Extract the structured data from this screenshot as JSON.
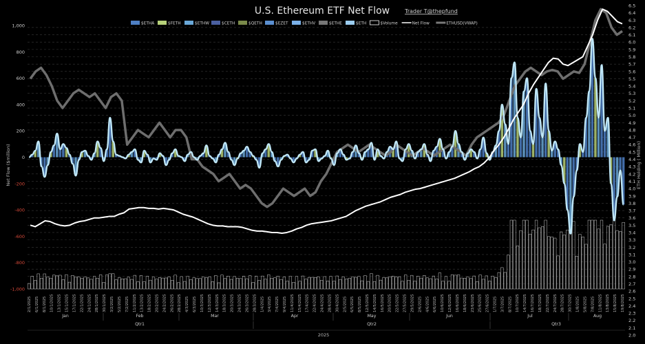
{
  "chart_data": {
    "type": "bar",
    "title": "U.S. Ethereum ETF Net Flow",
    "subtitle": "Trader T@thepfund",
    "ylabel_left": "Net Flow ($million)",
    "ylabel_right": "ETH Holding ( Million)",
    "left_ticks": [
      "1,000",
      "800",
      "600",
      "400",
      "200",
      "0",
      "-200",
      "-400",
      "-600",
      "-800",
      "-1,000"
    ],
    "left_tick_values": [
      1000,
      800,
      600,
      400,
      200,
      0,
      -200,
      -400,
      -600,
      -800,
      -1000
    ],
    "ylim_left": [
      -1000,
      1000
    ],
    "right_ticks": [
      "6.5",
      "6.4",
      "6.3",
      "6.2",
      "6.1",
      "6.0",
      "5.9",
      "5.8",
      "5.7",
      "5.6",
      "5.5",
      "5.4",
      "5.3",
      "5.2",
      "5.1",
      "5.0",
      "4.9",
      "4.8",
      "4.7",
      "4.6",
      "4.5",
      "4.4",
      "4.3",
      "4.2",
      "4.1",
      "4.0",
      "3.9",
      "3.8",
      "3.7",
      "3.6",
      "3.5",
      "3.4",
      "3.3",
      "3.2",
      "3.1",
      "3.0",
      "2.9",
      "2.8",
      "2.7",
      "2.6",
      "2.5",
      "2.4",
      "2.3",
      "2.2",
      "2.1",
      "2.0"
    ],
    "ylim_right": [
      2.0,
      6.5
    ],
    "legend": [
      "$ETHA",
      "$FETH",
      "$ETHW",
      "$CETH",
      "$QETH",
      "$EZET",
      "$ETHV",
      "$ETHE",
      "$ETH",
      "$Volume",
      "Net Flow",
      "ETHUSD(VWAP)"
    ],
    "legend_colors": [
      "#4e7fc4",
      "#b7d17a",
      "#6aa8d8",
      "#4a5fa0",
      "#7a8a4a",
      "#5b8fd0",
      "#7ab0e8",
      "#777777",
      "#9ccdf0",
      "#ffffff",
      "#ffffff",
      "#7a7a7a"
    ],
    "months": [
      "Jan",
      "Feb",
      "Mar",
      "Apr",
      "May",
      "Jun",
      "Jul",
      "Aug"
    ],
    "quarters": [
      "Qtr1",
      "Qtr2",
      "Qtr3"
    ],
    "year": "2025",
    "date_labels": [
      "2/1/2025",
      "6/1/2025",
      "8/1/2025",
      "10/1/2025",
      "13/1/2025",
      "15/1/2025",
      "17/1/2025",
      "22/1/2025",
      "24/1/2025",
      "28/1/2025",
      "30/1/2025",
      "3/2/2025",
      "5/2/2025",
      "7/2/2025",
      "11/2/2025",
      "13/2/2025",
      "18/2/2025",
      "20/2/2025",
      "24/2/2025",
      "26/2/2025",
      "28/2/2025",
      "4/3/2025",
      "6/3/2025",
      "10/3/2025",
      "12/3/2025",
      "14/3/2025",
      "18/3/2025",
      "20/3/2025",
      "24/3/2025",
      "26/3/2025",
      "28/3/2025",
      "1/4/2025",
      "3/4/2025",
      "7/4/2025",
      "9/4/2025",
      "11/4/2025",
      "15/4/2025",
      "17/4/2025",
      "22/4/2025",
      "24/4/2025",
      "28/4/2025",
      "30/4/2025",
      "2/5/2025",
      "6/5/2025",
      "8/5/2025",
      "12/5/2025",
      "14/5/2025",
      "16/5/2025",
      "20/5/2025",
      "22/5/2025",
      "27/5/2025",
      "29/5/2025",
      "2/6/2025",
      "4/6/2025",
      "6/6/2025",
      "10/6/2025",
      "12/6/2025",
      "16/6/2025",
      "18/6/2025",
      "23/6/2025",
      "25/6/2025",
      "27/6/2025",
      "1/7/2025",
      "3/7/2025",
      "8/7/2025",
      "10/7/2025",
      "14/7/2025",
      "16/7/2025",
      "18/7/2025",
      "22/7/2025",
      "24/7/2025",
      "28/7/2025",
      "30/7/2025",
      "1/8/2025",
      "5/8/2025",
      "7/8/2025",
      "11/8/2025",
      "13/8/2025",
      "15/8/2025",
      "19/8/2025"
    ],
    "netflow_series": [
      0,
      20,
      50,
      120,
      -70,
      -150,
      -60,
      40,
      90,
      180,
      60,
      100,
      70,
      20,
      -50,
      -140,
      -20,
      40,
      50,
      10,
      -20,
      30,
      120,
      70,
      -30,
      60,
      300,
      120,
      20,
      10,
      0,
      -10,
      20,
      40,
      60,
      -20,
      -40,
      50,
      20,
      -40,
      -10,
      -20,
      30,
      10,
      -60,
      -20,
      30,
      60,
      10,
      0,
      -30,
      20,
      40,
      0,
      -20,
      10,
      30,
      90,
      10,
      -10,
      -40,
      20,
      60,
      110,
      40,
      -20,
      -60,
      -10,
      30,
      50,
      80,
      40,
      10,
      -20,
      -80,
      30,
      60,
      100,
      40,
      -30,
      -70,
      -20,
      10,
      20,
      -10,
      -40,
      -10,
      20,
      40,
      -40,
      -20,
      50,
      60,
      -30,
      -10,
      10,
      50,
      -10,
      -60,
      30,
      60,
      20,
      -20,
      -10,
      40,
      90,
      30,
      -20,
      40,
      60,
      110,
      -20,
      60,
      10,
      -10,
      40,
      80,
      60,
      120,
      -10,
      -30,
      60,
      100,
      50,
      -10,
      40,
      60,
      100,
      20,
      -30,
      50,
      80,
      140,
      60,
      -10,
      40,
      80,
      200,
      100,
      40,
      -20,
      30,
      60,
      40,
      -10,
      60,
      150,
      30,
      -20,
      40,
      90,
      200,
      400,
      250,
      100,
      600,
      720,
      300,
      150,
      500,
      600,
      200,
      100,
      520,
      300,
      150,
      560,
      200,
      50,
      120,
      60,
      -60,
      -200,
      -400,
      -580,
      -300,
      -100,
      100,
      40,
      300,
      500,
      900,
      600,
      300,
      700,
      200,
      300,
      -200,
      -480,
      -300,
      -100,
      -360
    ],
    "holding_series_millions": [
      3.5,
      3.48,
      3.52,
      3.56,
      3.55,
      3.52,
      3.5,
      3.49,
      3.5,
      3.53,
      3.55,
      3.56,
      3.58,
      3.6,
      3.6,
      3.61,
      3.62,
      3.62,
      3.65,
      3.67,
      3.72,
      3.73,
      3.74,
      3.74,
      3.73,
      3.73,
      3.72,
      3.73,
      3.72,
      3.71,
      3.68,
      3.65,
      3.63,
      3.61,
      3.58,
      3.55,
      3.52,
      3.5,
      3.49,
      3.49,
      3.48,
      3.48,
      3.48,
      3.47,
      3.45,
      3.43,
      3.42,
      3.42,
      3.41,
      3.4,
      3.4,
      3.39,
      3.4,
      3.42,
      3.45,
      3.47,
      3.5,
      3.52,
      3.53,
      3.54,
      3.55,
      3.56,
      3.58,
      3.6,
      3.62,
      3.66,
      3.7,
      3.73,
      3.76,
      3.78,
      3.8,
      3.82,
      3.85,
      3.88,
      3.9,
      3.92,
      3.95,
      3.97,
      3.99,
      4.0,
      4.02,
      4.04,
      4.06,
      4.08,
      4.1,
      4.12,
      4.14,
      4.17,
      4.2,
      4.23,
      4.27,
      4.3,
      4.35,
      4.42,
      4.52,
      4.6,
      4.7,
      4.82,
      4.95,
      5.05,
      5.15,
      5.3,
      5.42,
      5.52,
      5.62,
      5.72,
      5.78,
      5.77,
      5.7,
      5.68,
      5.72,
      5.76,
      5.8,
      5.95,
      6.1,
      6.3,
      6.45,
      6.42,
      6.35,
      6.28,
      6.25
    ],
    "ethusd_scale": "mapped to right axis",
    "ethusd_series": [
      5.5,
      5.6,
      5.65,
      5.55,
      5.4,
      5.2,
      5.1,
      5.2,
      5.3,
      5.35,
      5.3,
      5.25,
      5.3,
      5.2,
      5.1,
      5.25,
      5.3,
      5.2,
      4.6,
      4.7,
      4.8,
      4.75,
      4.7,
      4.8,
      4.9,
      4.8,
      4.7,
      4.8,
      4.8,
      4.7,
      4.4,
      4.4,
      4.3,
      4.25,
      4.2,
      4.1,
      4.15,
      4.2,
      4.1,
      4.0,
      4.05,
      4.0,
      3.9,
      3.8,
      3.75,
      3.8,
      3.9,
      4.0,
      3.95,
      3.9,
      3.95,
      4.0,
      3.9,
      3.95,
      4.1,
      4.2,
      4.35,
      4.5,
      4.55,
      4.6,
      4.55,
      4.5,
      4.55,
      4.6,
      4.55,
      4.5,
      4.45,
      4.5,
      4.6,
      4.55,
      4.5,
      4.45,
      4.5,
      4.55,
      4.5,
      4.45,
      4.5,
      4.55,
      4.6,
      4.55,
      4.5,
      4.45,
      4.6,
      4.7,
      4.75,
      4.8,
      4.85,
      4.9,
      5.0,
      5.2,
      5.4,
      5.5,
      5.6,
      5.65,
      5.6,
      5.55,
      5.6,
      5.62,
      5.6,
      5.5,
      5.55,
      5.6,
      5.58,
      5.7,
      6.0,
      6.3,
      6.45,
      6.4,
      6.2,
      6.1,
      6.15
    ]
  }
}
